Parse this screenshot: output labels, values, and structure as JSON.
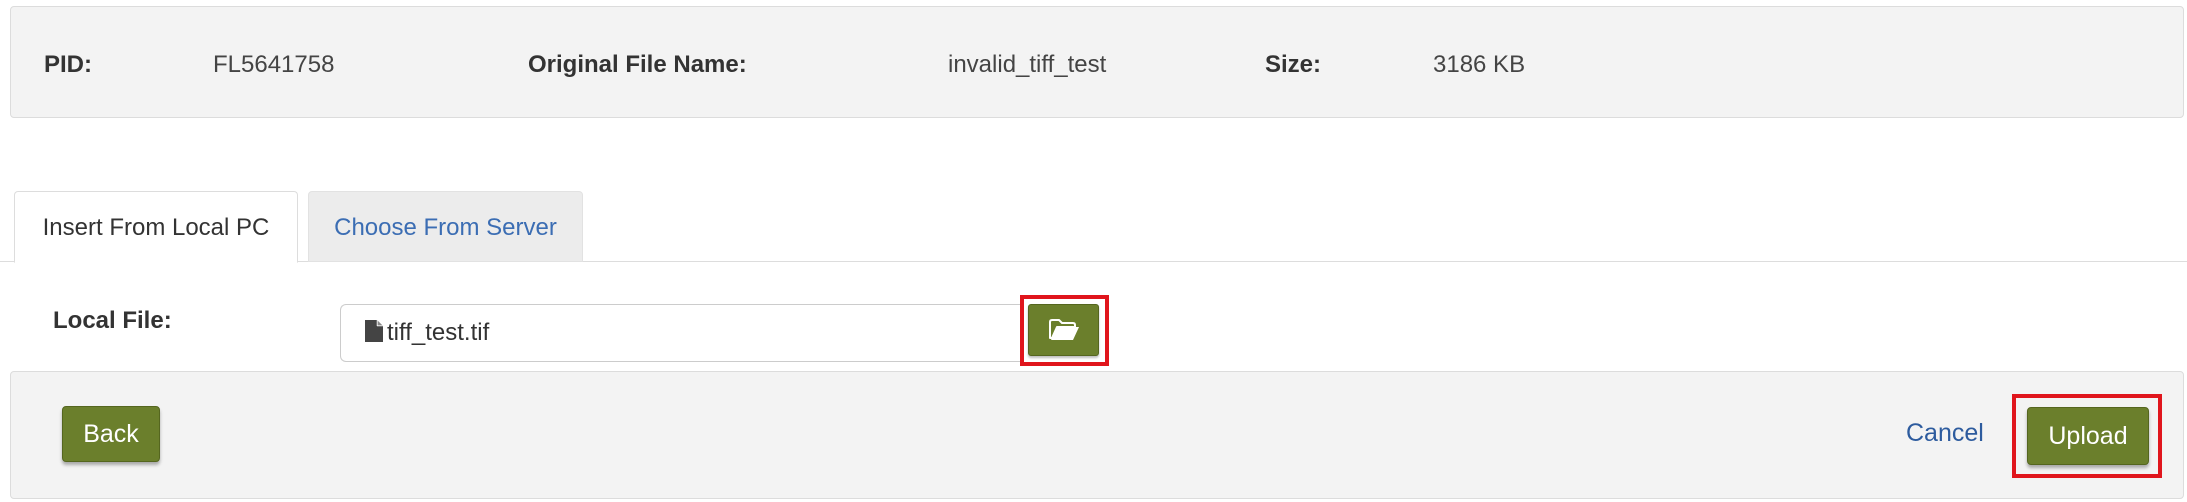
{
  "info": {
    "pid_label": "PID:",
    "pid_value": "FL5641758",
    "filename_label": "Original File Name:",
    "filename_value": "invalid_tiff_test",
    "size_label": "Size:",
    "size_value": "3186 KB"
  },
  "tabs": [
    {
      "label": "Insert From Local PC",
      "active": true
    },
    {
      "label": "Choose From Server",
      "active": false
    }
  ],
  "local_file": {
    "label": "Local File:",
    "value": "tiff_test.tif",
    "file_icon": "file-icon",
    "browse_icon": "folder-open-icon"
  },
  "footer": {
    "back_label": "Back",
    "cancel_label": "Cancel",
    "upload_label": "Upload"
  },
  "colors": {
    "button_green": "#6b7f2c",
    "link_blue": "#2d5b9e",
    "highlight_red": "#e0151c",
    "panel_gray": "#f3f3f3"
  }
}
